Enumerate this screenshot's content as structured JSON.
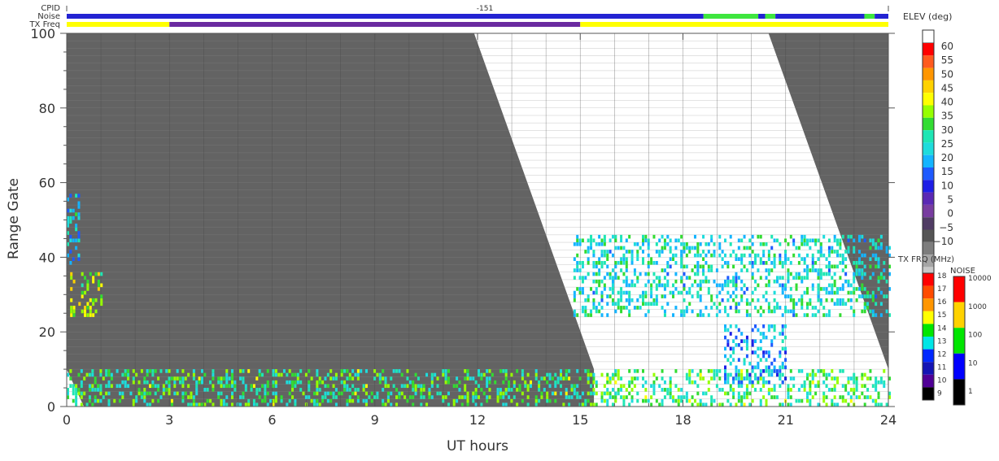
{
  "chart_data": {
    "type": "heatmap",
    "xlabel": "UT hours",
    "ylabel": "Range Gate",
    "xlim": [
      0,
      24
    ],
    "ylim": [
      0,
      100
    ],
    "xticks": [
      0,
      3,
      6,
      9,
      12,
      15,
      18,
      21,
      24
    ],
    "xtick_labels": [
      "0",
      "3",
      "6",
      "9",
      "12",
      "15",
      "18",
      "21",
      "24"
    ],
    "yticks": [
      0,
      20,
      40,
      60,
      80,
      100
    ],
    "ytick_labels": [
      "0",
      "20",
      "40",
      "60",
      "80",
      "100"
    ],
    "top_strips": {
      "cpid_label": "CPID",
      "cpid_value": "-151",
      "noise_label": "Noise",
      "txfreq_label": "TX Freq",
      "noise_segments": [
        {
          "start": 0,
          "end": 18.6,
          "level": "blue"
        },
        {
          "start": 18.6,
          "end": 20.2,
          "level": "green"
        },
        {
          "start": 20.2,
          "end": 20.4,
          "level": "blue"
        },
        {
          "start": 20.4,
          "end": 20.7,
          "level": "green"
        },
        {
          "start": 20.7,
          "end": 23.3,
          "level": "blue"
        },
        {
          "start": 23.3,
          "end": 23.6,
          "level": "green"
        },
        {
          "start": 23.6,
          "end": 24,
          "level": "blue"
        }
      ],
      "txfreq_segments": [
        {
          "start": 0,
          "end": 3,
          "mhz": 14
        },
        {
          "start": 3,
          "end": 15,
          "mhz": 10
        },
        {
          "start": 15,
          "end": 24,
          "mhz": 14
        }
      ]
    },
    "ground_scatter_region": {
      "description_color": "#636363",
      "boundary_left_gate0_hour": 0.5,
      "boundary_left_gate100_hour": 11.9,
      "boundary_right_gate0_hour": 15.4,
      "boundary_right_gate10_hour": 15.4,
      "boundary_second_gate100_hour": 20.5,
      "boundary_second_gate10_hour": 24
    },
    "scatter_clusters": [
      {
        "name": "early-blue",
        "hours": [
          0,
          0.35
        ],
        "gates": [
          38,
          57
        ],
        "elev": 18
      },
      {
        "name": "early-green",
        "hours": [
          0.1,
          1.0
        ],
        "gates": [
          24,
          36
        ],
        "elev": 37
      },
      {
        "name": "near-range",
        "hours": [
          0,
          24
        ],
        "gates": [
          0,
          10
        ],
        "elev": 28
      },
      {
        "name": "main-band",
        "hours": [
          14.8,
          24
        ],
        "gates": [
          24,
          46
        ],
        "elev": 22
      },
      {
        "name": "descending-arc",
        "hours": [
          19.2,
          21.0
        ],
        "gates": [
          6,
          22
        ],
        "elev": 14
      }
    ],
    "elev_colorbar": {
      "title": "ELEV (deg)",
      "labels": [
        "60",
        "55",
        "50",
        "45",
        "40",
        "35",
        "30",
        "25",
        "20",
        "15",
        "10",
        "5",
        "0",
        "−5",
        "−10"
      ],
      "colors": [
        "#ff0000",
        "#ff5a1e",
        "#ff9600",
        "#ffd200",
        "#ffff00",
        "#96ff00",
        "#32dc32",
        "#1ee6b4",
        "#1edcdc",
        "#14b4ff",
        "#1e5aff",
        "#1e1ee6",
        "#5a28b4",
        "#783ca0",
        "#503c64",
        "#555555",
        "#7d7d7d",
        "#a5a5a5",
        "#c8c8c8"
      ]
    },
    "freq_colorbar": {
      "title": "TX FRQ (MHz)",
      "labels": [
        "18",
        "17",
        "16",
        "15",
        "14",
        "13",
        "12",
        "11",
        "10",
        "9"
      ],
      "colors": [
        "#ff0000",
        "#ff4b00",
        "#ff9600",
        "#ffff00",
        "#00e600",
        "#00e6e6",
        "#0028ff",
        "#1414b4",
        "#500096",
        "#000000"
      ]
    },
    "noise_colorbar": {
      "title": "NOISE",
      "labels": [
        "10000",
        "1000",
        "100",
        "10",
        "1"
      ],
      "colors": [
        "#ff0000",
        "#ffd200",
        "#00e600",
        "#0000ff",
        "#000000"
      ]
    }
  }
}
